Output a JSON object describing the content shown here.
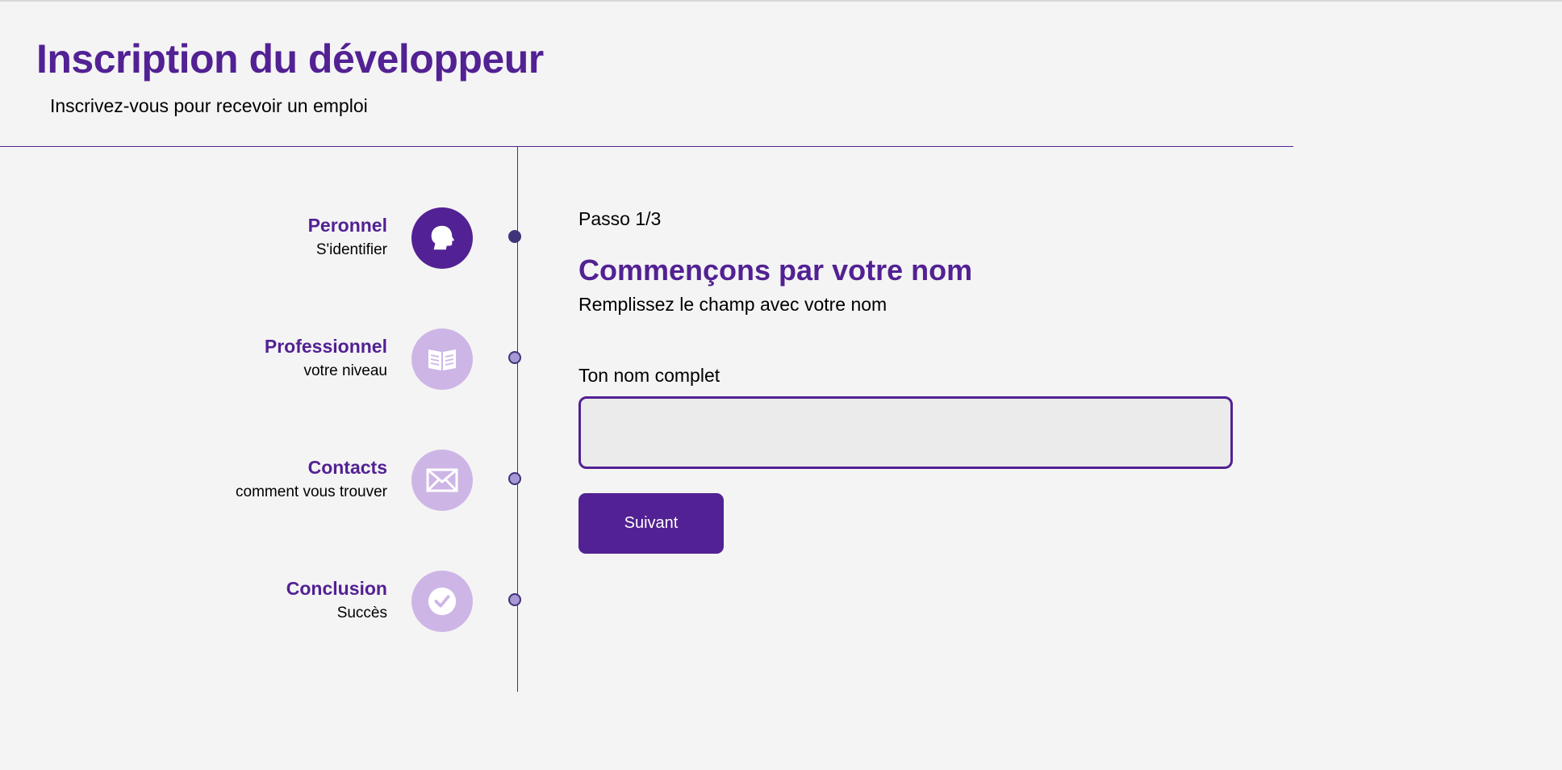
{
  "header": {
    "title": "Inscription du développeur",
    "subtitle": "Inscrivez-vous pour recevoir un emploi"
  },
  "steps": [
    {
      "title": "Peronnel",
      "description": "S'identifier",
      "icon": "user-head-icon",
      "active": true
    },
    {
      "title": "Professionnel",
      "description": "votre niveau",
      "icon": "book-icon",
      "active": false
    },
    {
      "title": "Contacts",
      "description": "comment vous trouver",
      "icon": "envelope-icon",
      "active": false
    },
    {
      "title": "Conclusion",
      "description": "Succès",
      "icon": "checkmark-icon",
      "active": false
    }
  ],
  "form": {
    "step_counter": "Passo 1/3",
    "heading": "Commençons par votre nom",
    "description": "Remplissez le champ avec votre nom",
    "field_label": "Ton nom complet",
    "field_value": "",
    "field_placeholder": "",
    "next_label": "Suivant"
  },
  "colors": {
    "primary": "#522193",
    "icon_inactive": "#cdb6e6",
    "background": "#f4f4f4",
    "input_background": "#ebebeb"
  }
}
